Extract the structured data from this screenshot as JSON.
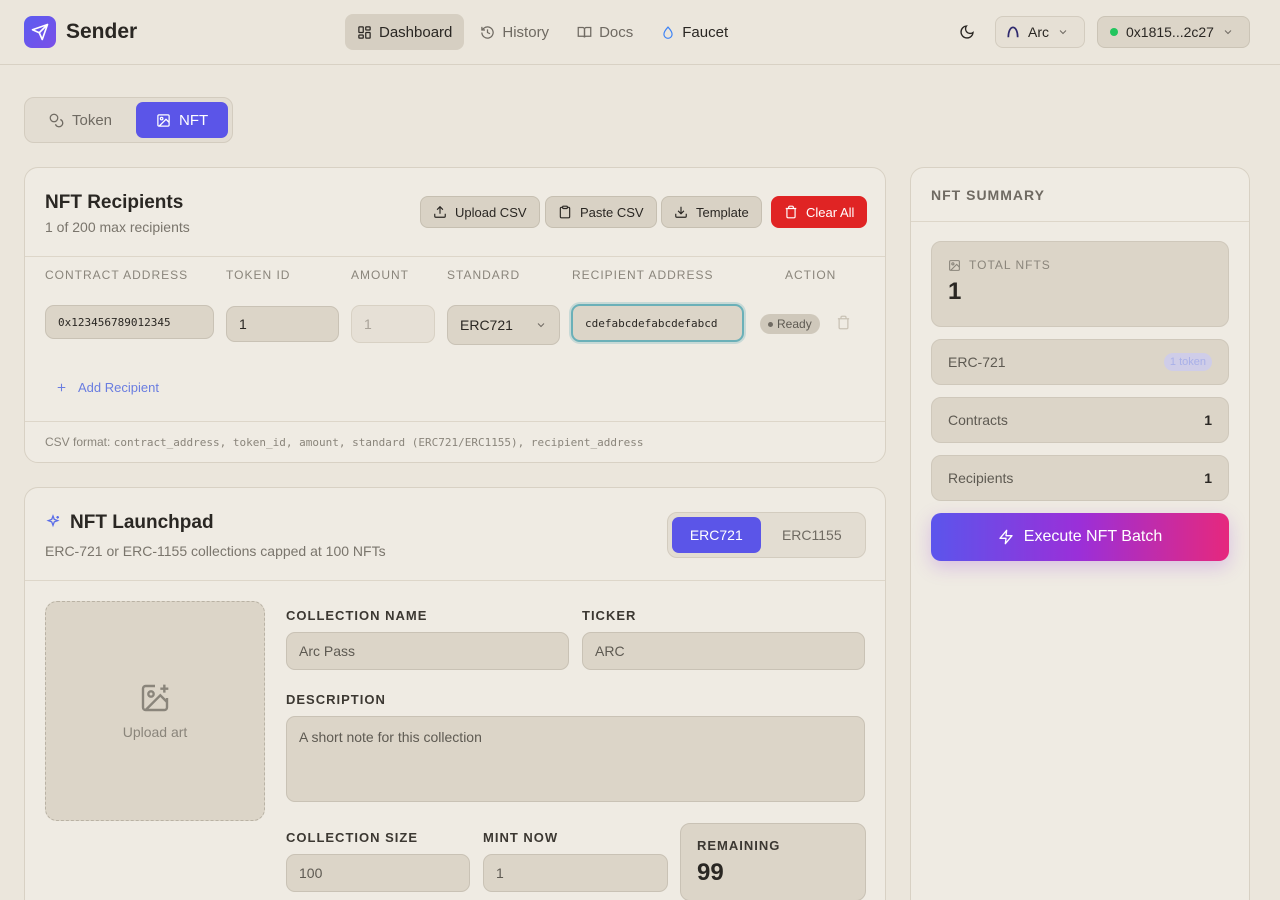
{
  "app": {
    "name": "Sender"
  },
  "nav": [
    {
      "label": "Dashboard",
      "icon": "dashboard-icon",
      "active": true
    },
    {
      "label": "History",
      "icon": "history-icon"
    },
    {
      "label": "Docs",
      "icon": "book-icon"
    },
    {
      "label": "Faucet",
      "icon": "droplet-icon"
    }
  ],
  "network": {
    "label": "Arc"
  },
  "wallet": {
    "address": "0x1815...2c27",
    "status_color": "#22c55e"
  },
  "mode": {
    "token_label": "Token",
    "nft_label": "NFT",
    "active": "NFT"
  },
  "recipients": {
    "title": "NFT Recipients",
    "subtitle": "1 of 200 max recipients",
    "buttons": {
      "upload": "Upload CSV",
      "paste": "Paste CSV",
      "template": "Template",
      "clear": "Clear All"
    },
    "columns": [
      "CONTRACT ADDRESS",
      "TOKEN ID",
      "AMOUNT",
      "STANDARD",
      "RECIPIENT ADDRESS",
      "ACTION"
    ],
    "rows": [
      {
        "contract": "0x123456789012345",
        "token_id": "1",
        "amount": "1",
        "standard": "ERC721",
        "recipient": "cdefabcdefabcdefabcd",
        "status": "Ready"
      }
    ],
    "add_label": "Add Recipient",
    "csv_prefix": "CSV format:",
    "csv_format": "contract_address, token_id, amount, standard (ERC721/ERC1155), recipient_address"
  },
  "summary": {
    "title": "NFT SUMMARY",
    "total_label": "TOTAL NFTS",
    "total_value": "1",
    "standard_label": "ERC-721",
    "standard_badge": "1 token",
    "contracts_label": "Contracts",
    "contracts_value": "1",
    "recipients_label": "Recipients",
    "recipients_value": "1",
    "execute_label": "Execute NFT Batch"
  },
  "launchpad": {
    "title": "NFT Launchpad",
    "subtitle": "ERC-721 or ERC-1155 collections capped at 100 NFTs",
    "std_721": "ERC721",
    "std_1155": "ERC1155",
    "upload_label": "Upload art",
    "collection_name_label": "COLLECTION NAME",
    "collection_name_value": "Arc Pass",
    "ticker_label": "TICKER",
    "ticker_value": "ARC",
    "description_label": "DESCRIPTION",
    "description_placeholder": "A short note for this collection",
    "collection_size_label": "COLLECTION SIZE",
    "collection_size_value": "100",
    "mint_now_label": "MINT NOW",
    "mint_now_value": "1",
    "remaining_label": "REMAINING",
    "remaining_value": "99"
  },
  "colors": {
    "accent": "#5b55e8",
    "danger": "#e02424",
    "background": "#ebe6dc"
  }
}
